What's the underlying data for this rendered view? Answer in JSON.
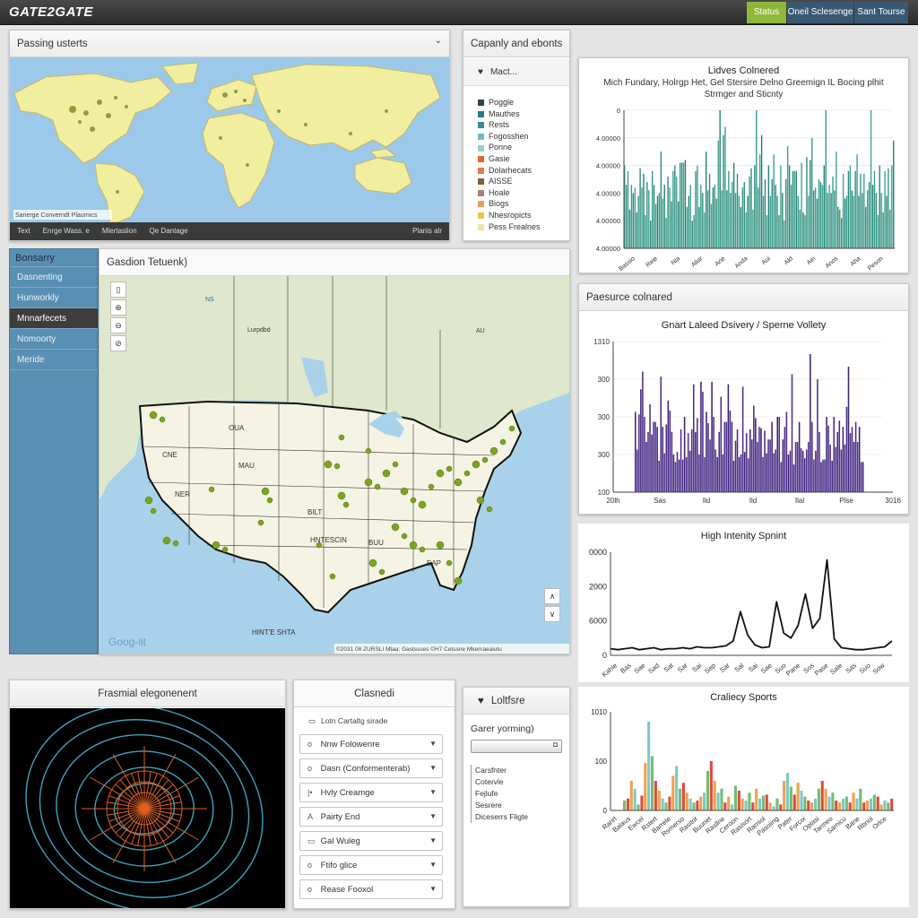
{
  "app": {
    "title": "GATE2GATE",
    "buttons": [
      "Status",
      "Oneil Sclesenge",
      "Sant Tourse"
    ],
    "accent": "#8fb83b",
    "bar_color": "#3a5872"
  },
  "world_panel": {
    "title": "Passing usterts",
    "attribution": "Sanerge Converndt Plaurnics",
    "footer": [
      "Text",
      "Enrge Wass. e",
      "Mlertaslion",
      "Qe Dantage"
    ],
    "footer_right": "Planis alr"
  },
  "legend_panel": {
    "title": "Capanly and ebonts",
    "header": "Mact...",
    "items": [
      {
        "label": "Poggle",
        "color": "#2d4a3a"
      },
      {
        "label": "Mauthes",
        "color": "#2a7a8c"
      },
      {
        "label": "Rests",
        "color": "#2f8f9a"
      },
      {
        "label": "Fogosshen",
        "color": "#6fbdc4"
      },
      {
        "label": "Ponne",
        "color": "#9bcfc8"
      },
      {
        "label": "Gasie",
        "color": "#e46a2a"
      },
      {
        "label": "Dolarhecats",
        "color": "#e07b4a"
      },
      {
        "label": "AISSE",
        "color": "#8a5a3a"
      },
      {
        "label": "Hoale",
        "color": "#b07a7a"
      },
      {
        "label": "Biogs",
        "color": "#e8a060"
      },
      {
        "label": "Nhesropicts",
        "color": "#e6c84a"
      },
      {
        "label": "Pess Frealnes",
        "color": "#f2e6a0"
      }
    ]
  },
  "chart1": {
    "title": "Lidves Colnered",
    "subtitle1": "Mich Fundary, Holrgp Het, Gel Stersire Delno Greemign IL Bocing plhit",
    "subtitle2": "Strmger and Sticnty"
  },
  "sidebar": {
    "title": "Bonsarry",
    "items": [
      "Dasnenting",
      "Hunworkly",
      "Mnnarfecets",
      "Nomoorty",
      "Meride"
    ],
    "selected": 2
  },
  "us_panel": {
    "title": "Gasdion Tetuenk)",
    "google": "Goog-lit",
    "attribution": "©2031 08 ZURSLI Mtaa: Gastssses ©H7 Cetssne Mkemaeaiutu",
    "labels": [
      "CNE",
      "OUA",
      "MAU",
      "NER",
      "BILT",
      "HNTESCIN",
      "BUU",
      "EAP",
      "HINT'E SHTA",
      "Lurpdbd",
      "AU",
      "NS"
    ]
  },
  "us_zoom": [
    "▯",
    "⊕",
    "⊖",
    "⊘"
  ],
  "section2": {
    "title": "Paesurce colnared"
  },
  "chart2": {
    "title": "Gnart Laleed Dsivery / Sperne Vollety"
  },
  "chart3": {
    "title": "High Intenity Spnint"
  },
  "chart4": {
    "title": "Craliecy Sports"
  },
  "radial_panel": {
    "title": "Frasmial elegonenent"
  },
  "filter_panel": {
    "title": "Clasnedi",
    "subtitle": "Lotn Cartaltg sirade",
    "rows": [
      {
        "icon": "o",
        "label": "Nnw Folowenre"
      },
      {
        "icon": "o",
        "label": "Dasn (Conformenterab)"
      },
      {
        "icon": "|•",
        "label": "Hvly Creamge"
      },
      {
        "icon": "A",
        "label": "Pairty End"
      },
      {
        "icon": "▭",
        "label": "Gal Wuleg"
      },
      {
        "icon": "o",
        "label": "Ftifo glice"
      },
      {
        "icon": "o",
        "label": "Rease Fooxol"
      }
    ]
  },
  "right_small_panel": {
    "title": "Loltfsre",
    "label": "Garer yorming)",
    "options": [
      "Carsfnter",
      "Cotervle",
      "Fejlufe",
      "Sesrere",
      "Diceserrs Fligte"
    ]
  },
  "chart_data": [
    {
      "type": "bar",
      "title": "Lidves Colnered",
      "ylim": [
        0,
        5
      ],
      "yticks": [
        "0",
        "4.00000",
        "4.00000",
        "4.00000",
        "4.00000",
        "4.00000"
      ],
      "xticks": [
        "Bassio",
        "Reie",
        "Nia",
        "Aliar",
        "Arie",
        "Anda",
        "Aui",
        "Ald",
        "Ain",
        "Anos",
        "Aha",
        "Peson"
      ],
      "values": [
        3.0,
        2.3,
        2.8,
        1.4,
        2.3,
        2.0,
        2.2,
        1.3,
        1.9,
        2.9,
        2.2,
        2.7,
        1.2,
        2.4,
        2.1,
        1.0,
        2.8,
        2.3,
        1.6,
        1.9,
        2.0,
        3.5,
        1.8,
        2.3,
        1.1,
        2.6,
        2.2,
        1.7,
        2.8,
        3.0,
        2.6,
        1.7,
        3.1,
        3.1,
        3.1,
        3.2,
        1.5,
        1.9,
        2.3,
        1.0,
        1.2,
        2.8,
        3.0,
        1.5,
        2.3,
        2.0,
        1.3,
        3.5,
        2.1,
        2.7,
        1.6,
        2.2,
        2.3,
        1.8,
        3.9,
        5.0,
        2.1,
        4.1,
        4.4,
        2.1,
        2.8,
        2.0,
        2.4,
        3.1,
        2.0,
        2.7,
        1.9,
        1.5,
        2.2,
        2.4,
        1.3,
        1.9,
        2.6,
        2.9,
        1.4,
        3.0,
        5.0,
        2.2,
        3.4,
        4.1,
        1.9,
        2.5,
        1.2,
        3.0,
        1.9,
        2.5,
        3.4,
        2.3,
        1.9,
        1.2,
        3.0,
        2.0,
        1.0,
        2.5,
        3.7,
        3.0,
        2.3,
        2.8,
        2.8,
        2.8,
        1.9,
        1.4,
        3.1,
        1.3,
        1.2,
        3.3,
        1.9,
        3.2,
        4.0,
        2.1,
        2.2,
        1.8,
        2.5,
        2.4,
        2.3,
        3.0,
        5.0,
        2.0,
        2.3,
        2.0,
        2.6,
        2.1,
        3.5,
        1.5,
        1.4,
        1.1,
        2.7,
        1.8,
        1.9,
        2.8,
        3.0,
        2.1,
        1.9,
        2.8,
        3.4,
        1.9,
        2.7,
        2.0,
        2.7,
        1.5,
        2.1,
        2.4,
        5.0,
        2.3,
        2.8,
        2.0,
        1.2,
        3.0,
        2.0,
        1.3,
        2.8,
        1.9,
        2.9,
        1.4,
        3.0,
        3.9
      ]
    },
    {
      "type": "bar",
      "title": "Gnart Laleed Dsivery / Sperne Vollety",
      "ylim": [
        0,
        1200
      ],
      "yticks": [
        "1310",
        "300",
        "300",
        "300",
        "100"
      ],
      "xticks": [
        "20lh",
        "Sas",
        "Ild",
        "Ild",
        "Ilal",
        "Plse",
        "3016"
      ],
      "values": [
        640,
        340,
        620,
        820,
        960,
        600,
        400,
        480,
        700,
        460,
        560,
        560,
        520,
        250,
        920,
        520,
        310,
        540,
        730,
        650,
        480,
        300,
        240,
        320,
        260,
        500,
        260,
        600,
        280,
        470,
        330,
        500,
        860,
        480,
        590,
        300,
        880,
        800,
        280,
        640,
        550,
        420,
        880,
        600,
        340,
        280,
        480,
        760,
        300,
        560,
        560,
        860,
        650,
        560,
        250,
        410,
        500,
        280,
        300,
        840,
        320,
        470,
        270,
        500,
        420,
        690,
        590,
        400,
        520,
        510,
        280,
        490,
        310,
        420,
        420,
        560,
        310,
        340,
        600,
        600,
        240,
        420,
        520,
        640,
        300,
        330,
        940,
        220,
        400,
        400,
        560,
        350,
        330,
        270,
        340,
        400,
        1100,
        560,
        260,
        330,
        900,
        480,
        240,
        260,
        260,
        600,
        530,
        380,
        250,
        600,
        360,
        480,
        570,
        340,
        520,
        380,
        680,
        1000,
        470,
        520,
        400,
        560,
        400,
        520,
        240,
        240
      ]
    },
    {
      "type": "line",
      "title": "High Intenity Spnint",
      "yticks": [
        "0000",
        "2000",
        "6000",
        "0"
      ],
      "xticks": [
        "Kahle",
        "Bas",
        "Sae",
        "Sad",
        "Sat",
        "Sar",
        "Sai",
        "Sep",
        "Sar",
        "Sal",
        "Sai",
        "Sae",
        "Suo",
        "Pane",
        "Sos",
        "Pase",
        "Sale",
        "Sas",
        "Suo",
        "Sow"
      ],
      "values": [
        0.04,
        0.03,
        0.04,
        0.05,
        0.03,
        0.04,
        0.05,
        0.03,
        0.04,
        0.04,
        0.05,
        0.04,
        0.06,
        0.05,
        0.05,
        0.06,
        0.07,
        0.12,
        0.42,
        0.18,
        0.08,
        0.05,
        0.06,
        0.52,
        0.2,
        0.15,
        0.28,
        0.6,
        0.25,
        0.35,
        0.95,
        0.14,
        0.05,
        0.04,
        0.03,
        0.03,
        0.04,
        0.05,
        0.06,
        0.12
      ]
    },
    {
      "type": "bar",
      "title": "Craliecy Sports",
      "ylim": [
        0,
        100
      ],
      "yticks": [
        "1010",
        "100",
        "0"
      ],
      "series": [
        {
          "name": "green",
          "color": "#6fbf73"
        },
        {
          "name": "red",
          "color": "#e04a3a"
        },
        {
          "name": "orange",
          "color": "#f0a24a"
        },
        {
          "name": "teal",
          "color": "#7ec8c9"
        }
      ],
      "xticks": [
        "Rarirt",
        "Balaus",
        "Ewcel",
        "Rstert",
        "Barrete",
        "Rsmerso",
        "Rasitor",
        "Buuriet",
        "Rasllne",
        "Ceroon",
        "Rasisort",
        "Rarniol",
        "Pasoiing",
        "Pater",
        "Forcoi",
        "Oplasi",
        "Tarmeo",
        "Sarnicu",
        "Bane",
        "Rbnoi",
        "Orlce"
      ],
      "values": [
        10,
        12,
        30,
        22,
        6,
        15,
        48,
        90,
        55,
        30,
        20,
        12,
        8,
        14,
        35,
        45,
        22,
        28,
        18,
        12,
        8,
        10,
        14,
        18,
        40,
        50,
        30,
        18,
        22,
        8,
        14,
        6,
        25,
        20,
        12,
        10,
        18,
        8,
        22,
        12,
        15,
        16,
        8,
        4,
        12,
        6,
        30,
        38,
        24,
        16,
        28,
        20,
        14,
        10,
        8,
        12,
        22,
        30,
        22,
        14,
        18,
        10,
        8,
        12,
        14,
        8,
        18,
        12,
        22,
        8,
        10,
        12,
        16,
        14,
        6,
        10,
        8,
        12
      ]
    }
  ]
}
